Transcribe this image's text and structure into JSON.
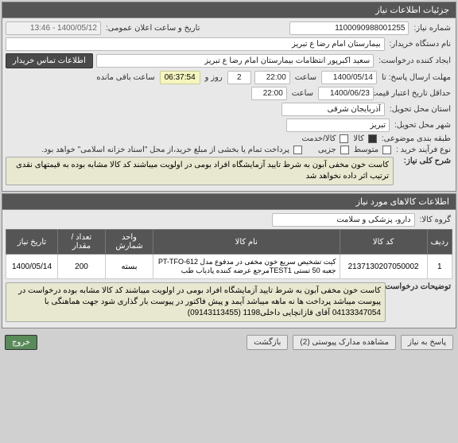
{
  "panel1": {
    "title": "جزئیات اطلاعات نیاز",
    "need_number_label": "شماره نیاز:",
    "need_number": "1100090988001255",
    "announce_label": "تاریخ و ساعت اعلان عمومی:",
    "announce_value": "1400/05/12 - 13:46",
    "buyer_label": "نام دستگاه خریدار:",
    "buyer_value": "بیمارستان امام رضا  ع  تبریز",
    "requester_label": "ایجاد کننده درخواست:",
    "requester_value": "سعید اکبرپور انتظامات بیمارستان امام رضا  ع  تبریز",
    "contact_btn": "اطلاعات تماس خریدار",
    "deadline_label": "مهلت ارسال پاسخ: تا",
    "deadline_date": "1400/05/14",
    "deadline_time_label": "ساعت",
    "deadline_time": "22:00",
    "days_label": "روز و",
    "days_value": "2",
    "remain_time": "06:37:54",
    "remain_label": "ساعت باقی مانده",
    "validity_label": "حداقل تاریخ اعتبار قیمت تا تاریخ:",
    "validity_date": "1400/06/23",
    "validity_time_label": "ساعت",
    "validity_time": "22:00",
    "province_label": "استان محل تحویل:",
    "province_value": "آذربایجان شرقی",
    "city_label": "شهر محل تحویل:",
    "city_value": "تبریز",
    "category_label": "طبقه بندی موضوعی:",
    "cat_goods": "کالا",
    "cat_service": "کالا/خدمت",
    "purchase_type_label": "نوع فرآیند خرید :",
    "purchase_type_opt1": "متوسط",
    "purchase_type_opt2": "جزیی",
    "payment_note": "پرداخت تمام یا بخشی از مبلغ خرید،از محل \"اسناد خزانه اسلامی\" خواهد بود.",
    "summary_label": "شرح کلی نیاز:",
    "summary_text": "کاست خون مخفی آبون به شرط تایید آزمایشگاه افراد بومی در اولویت میباشند کد کالا مشابه بوده به قیمتهای نقدی ترتیب اثر داده نخواهد شد"
  },
  "panel2": {
    "title": "اطلاعات کالاهای مورد نیاز",
    "group_label": "گروه کالا:",
    "group_value": "دارو، پزشکی و سلامت",
    "headers": {
      "row": "ردیف",
      "code": "کد کالا",
      "name": "نام کالا",
      "unit": "واحد شمارش",
      "qty": "تعداد / مقدار",
      "date": "تاریخ نیاز"
    },
    "rows": [
      {
        "row": "1",
        "code": "2137130207050002",
        "name": "کیت تشخیص سریع خون مخفی در مدفوع مدل PT-TFO-612 جعبه 50 تستی TEST1مرجع عرضه کننده پادیاب طب",
        "unit": "بسته",
        "qty": "200",
        "date": "1400/05/14"
      }
    ],
    "desc_label": "توضیحات درخواست:",
    "desc_text": "کاست خون مخفی آبون به شرط تایید آزمایشگاه افراد بومی در اولویت میباشند کد کالا مشابه بوده درخواست در پیوست میباشد پرداخت ها نه ماهه میباشد آیمد و پیش فاکتور در پیوست بار گذاری شود جهت هماهنگی با 04133347054  آقای قازانچایی داخلی1198 (09143113455)"
  },
  "buttons": {
    "reply": "پاسخ به نیاز",
    "attachments": "مشاهده مدارک پیوستی (2)",
    "back": "بازگشت",
    "exit": "خروج"
  }
}
